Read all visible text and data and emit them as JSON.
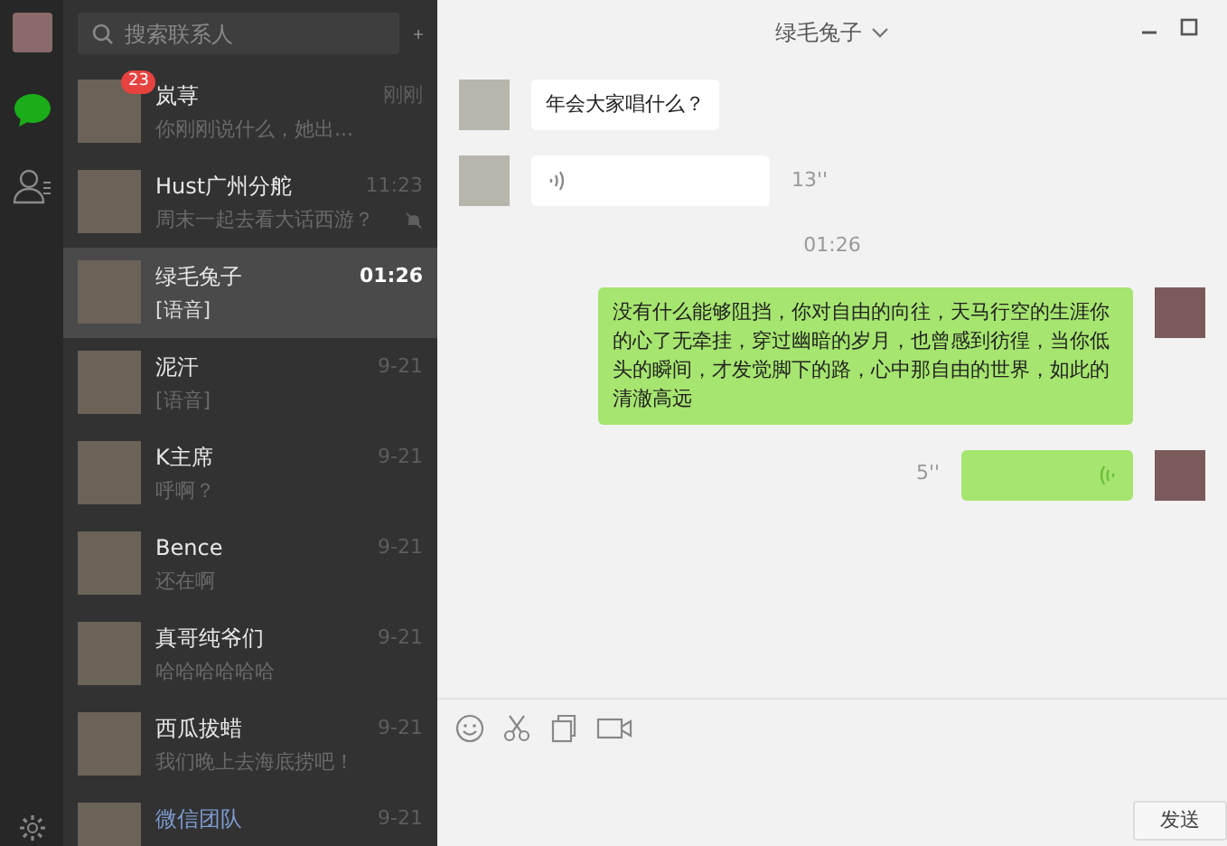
{
  "sidebar": {
    "nav": [
      {
        "kind": "chats",
        "selected": true
      },
      {
        "kind": "contacts",
        "selected": false
      }
    ]
  },
  "search": {
    "placeholder": "搜索联系人"
  },
  "chats": [
    {
      "name": "岚荨",
      "preview": "你刚刚说什么，她出...",
      "time": "刚刚",
      "badge": "23",
      "muted": false,
      "selected": false,
      "official": false
    },
    {
      "name": "Hust广州分舵",
      "preview": "周末一起去看大话西游？",
      "time": "11:23",
      "muted": true,
      "selected": false,
      "official": false
    },
    {
      "name": "绿毛兔子",
      "preview": "[语音]",
      "time": "01:26",
      "muted": false,
      "selected": true,
      "official": false
    },
    {
      "name": "泥汗",
      "preview": "[语音]",
      "time": "9-21",
      "muted": false,
      "selected": false,
      "official": false
    },
    {
      "name": "K主席",
      "preview": "呼啊？",
      "time": "9-21",
      "muted": false,
      "selected": false,
      "official": false
    },
    {
      "name": "Bence",
      "preview": "还在啊",
      "time": "9-21",
      "muted": false,
      "selected": false,
      "official": false
    },
    {
      "name": "真哥纯爷们",
      "preview": "哈哈哈哈哈哈",
      "time": "9-21",
      "muted": false,
      "selected": false,
      "official": false
    },
    {
      "name": "西瓜拔蜡",
      "preview": "我们晚上去海底捞吧！",
      "time": "9-21",
      "muted": false,
      "selected": false,
      "official": false
    },
    {
      "name": "微信团队",
      "time": "9-21",
      "muted": false,
      "selected": false,
      "official": true
    }
  ],
  "conversation": {
    "title": "绿毛兔子",
    "messages": [
      {
        "kind": "text",
        "outgoing": false,
        "text": "年会大家唱什么？"
      },
      {
        "kind": "voice",
        "outgoing": false,
        "duration": "13''"
      },
      {
        "kind": "time",
        "text": "01:26"
      },
      {
        "kind": "text",
        "outgoing": true,
        "text": "没有什么能够阻挡，你对自由的向往，天马行空的生涯你的心了无牵挂，穿过幽暗的岁月，也曾感到彷徨，当你低头的瞬间，才发觉脚下的路，心中那自由的世界，如此的清澈高远"
      },
      {
        "kind": "voice",
        "outgoing": true,
        "duration": "5''"
      }
    ]
  },
  "send_button": "发送"
}
